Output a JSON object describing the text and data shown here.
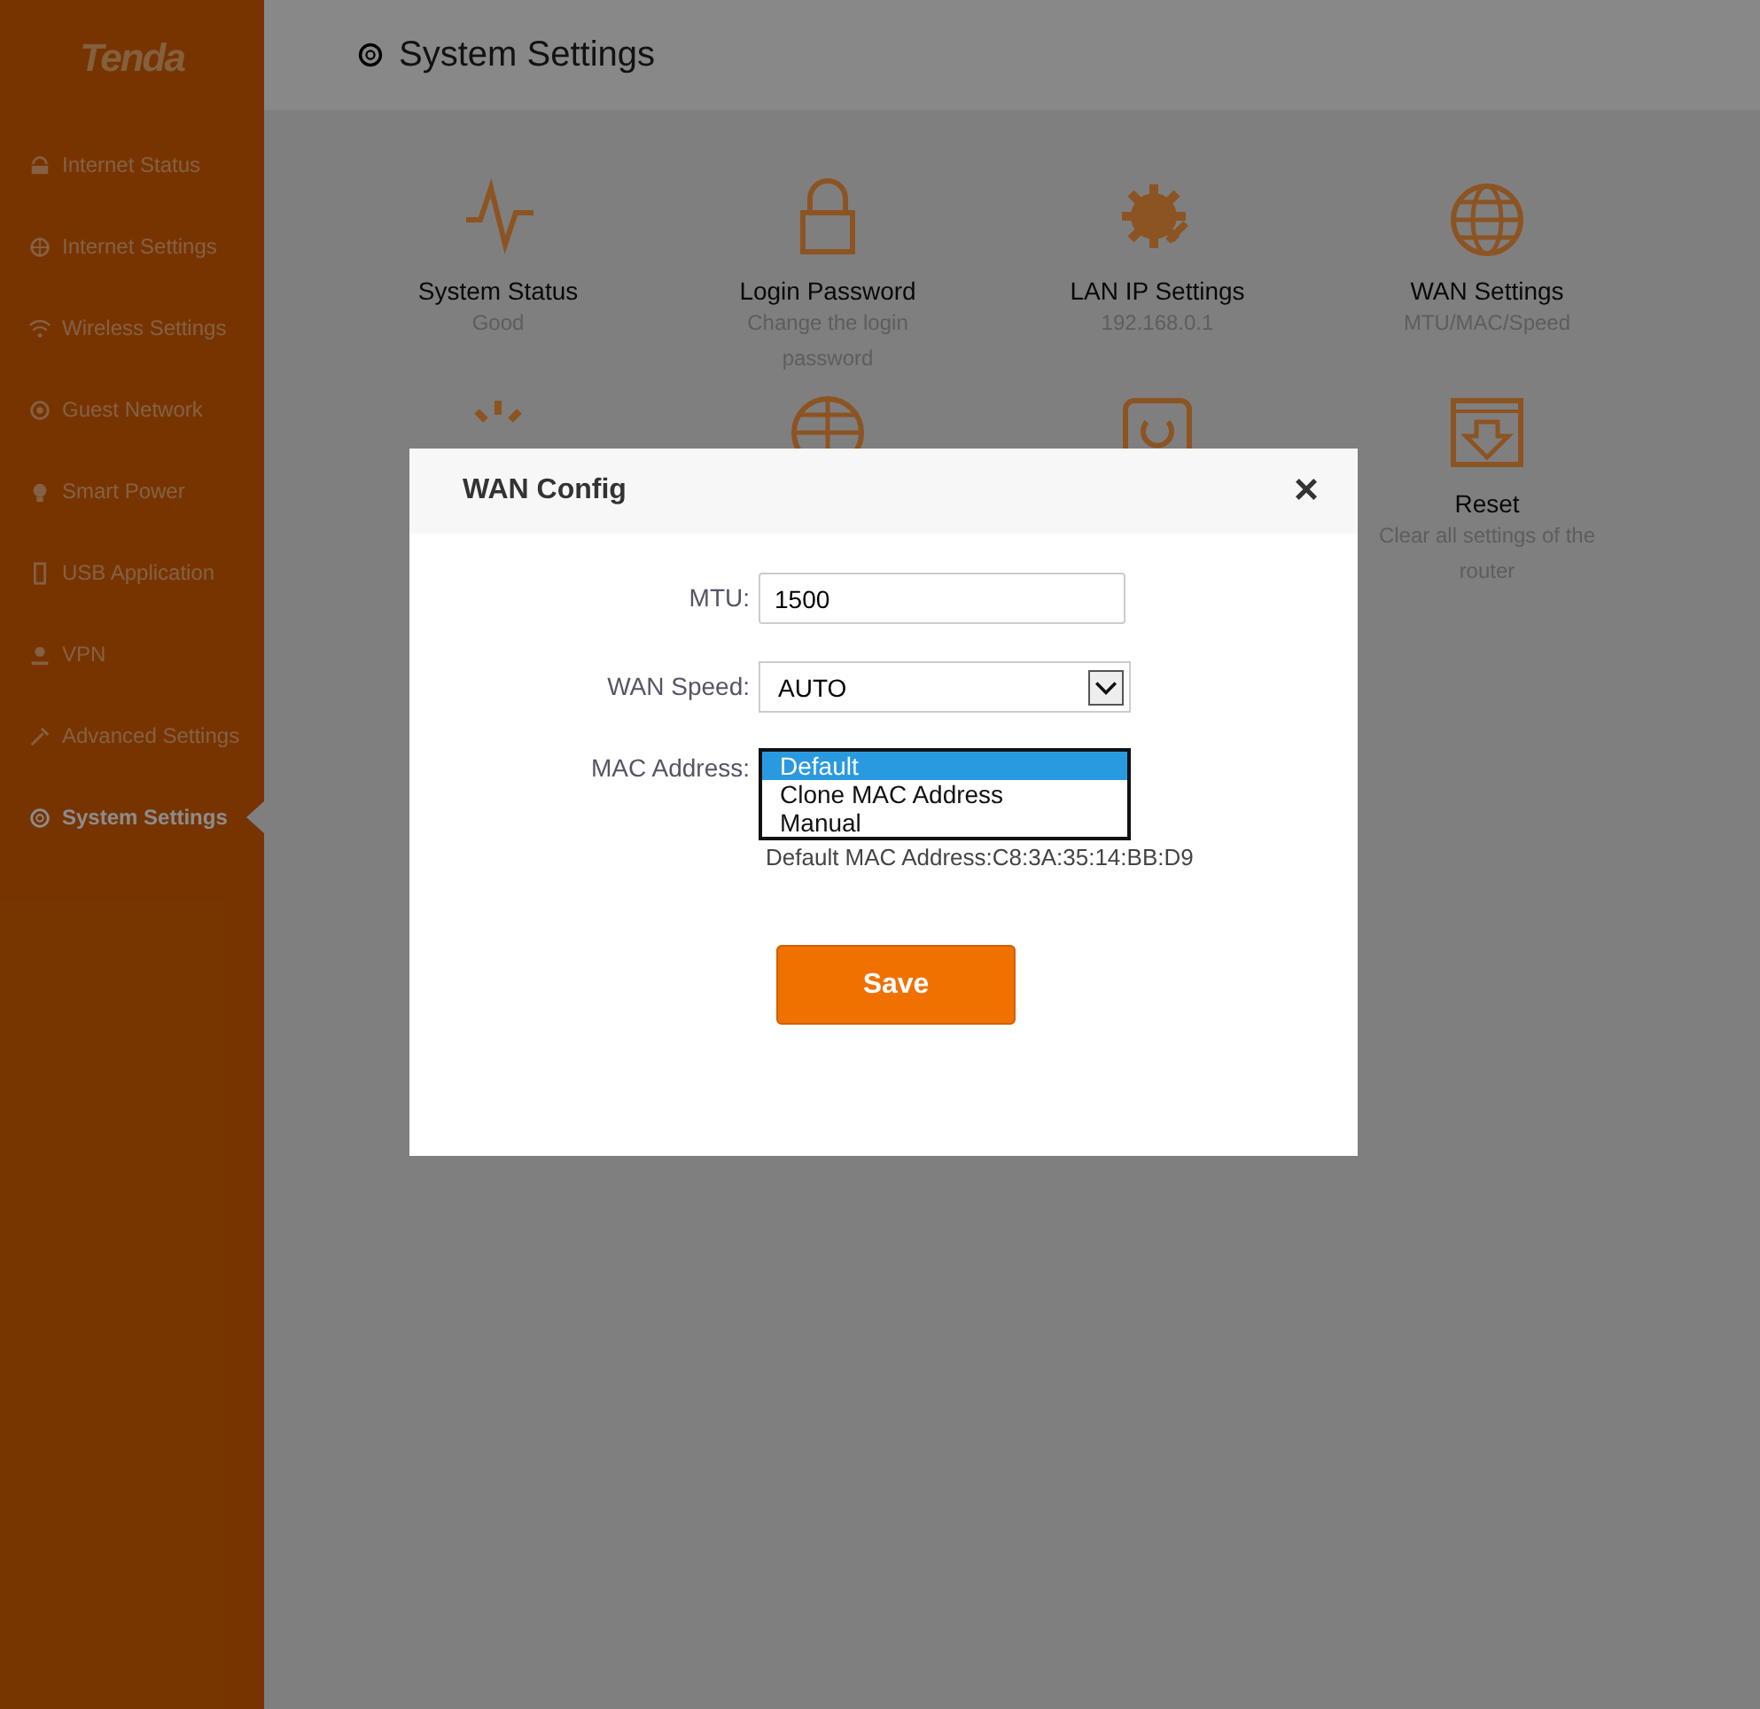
{
  "sidebar": {
    "logo": "Tenda",
    "items": [
      {
        "label": "Internet Status",
        "selected": false
      },
      {
        "label": "Internet Settings",
        "selected": false
      },
      {
        "label": "Wireless Settings",
        "selected": false
      },
      {
        "label": "Guest Network",
        "selected": false
      },
      {
        "label": "Smart Power",
        "selected": false
      },
      {
        "label": "USB Application",
        "selected": false
      },
      {
        "label": "VPN",
        "selected": false
      },
      {
        "label": "Advanced Settings",
        "selected": false
      },
      {
        "label": "System Settings",
        "selected": true
      }
    ]
  },
  "header": {
    "title": "System Settings"
  },
  "tiles": [
    {
      "title": "System Status",
      "subtitle": "Good"
    },
    {
      "title": "Login Password",
      "subtitle": "Change the login password"
    },
    {
      "title": "LAN IP Settings",
      "subtitle": "192.168.0.1"
    },
    {
      "title": "WAN Settings",
      "subtitle": "MTU/MAC/Speed"
    },
    {
      "title": "Reset",
      "subtitle": "Clear all settings of the router"
    }
  ],
  "dialog": {
    "title": "WAN Config",
    "close": "×",
    "mtu": {
      "label": "MTU:",
      "value": "1500"
    },
    "wan_speed": {
      "label": "WAN Speed:",
      "value": "AUTO"
    },
    "mac_address": {
      "label": "MAC Address:",
      "options": [
        {
          "label": "Default",
          "selected": true
        },
        {
          "label": "Clone MAC Address",
          "selected": false
        },
        {
          "label": "Manual",
          "selected": false
        }
      ],
      "note": "Default MAC Address:C8:3A:35:14:BB:D9"
    },
    "save": "Save"
  }
}
